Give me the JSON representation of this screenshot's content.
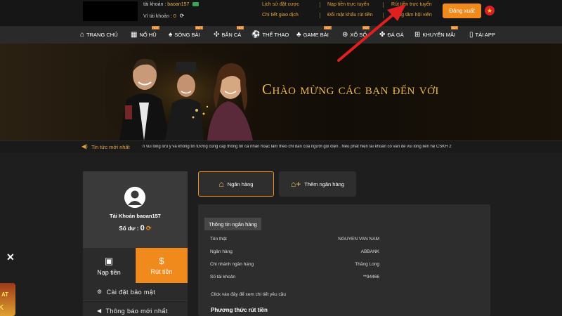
{
  "account": {
    "username_label": "tài khoản :",
    "username": "baoan157",
    "wallet_label": "Ví tài khoản :",
    "wallet_value": "0"
  },
  "top_links": [
    {
      "label": "Lịch sử đặt cược"
    },
    {
      "label": "Nạp tiền trực tuyến"
    },
    {
      "label": "Rút tiền trực tuyến"
    },
    {
      "label": "Chi tiết giao dịch"
    },
    {
      "label": "Đổi mật khẩu rút tiền"
    },
    {
      "label": "Trung tâm hội viên"
    }
  ],
  "logout_label": "Đăng xuất",
  "nav": [
    {
      "label": "TRANG CHỦ",
      "icon": "home-icon"
    },
    {
      "label": "NỔ HŨ",
      "icon": "slot-icon"
    },
    {
      "label": "SÒNG BÀI",
      "icon": "casino-icon"
    },
    {
      "label": "BẮN CÁ",
      "icon": "fish-icon"
    },
    {
      "label": "THỂ THAO",
      "icon": "soccer-ball-icon"
    },
    {
      "label": "GAME BÀI",
      "icon": "cards-icon"
    },
    {
      "label": "XỔ SỐ",
      "icon": "lottery-icon"
    },
    {
      "label": "ĐÁ GÀ",
      "icon": "rooster-icon"
    },
    {
      "label": "KHUYẾN MÃI",
      "icon": "gift-icon"
    },
    {
      "label": "TẢI APP",
      "icon": "phone-icon"
    }
  ],
  "hot_badge": "HOT",
  "banner": {
    "title": "Chào mừng các bạn đến với"
  },
  "ticker": {
    "label": "Tin tức mới nhất",
    "text": "n vui lòng lưu ý và không tin tưởng cung cấp thông tin cá nhân hoặc làm theo chỉ dẫn của người gọi điện . Nếu phát hiện tài khoản có vấn đề vui lòng liên hệ CSKH 2"
  },
  "profile": {
    "account_label": "Tài Khoản",
    "username": "baoan157",
    "balance_label": "Số dư :",
    "balance": "0"
  },
  "actions": {
    "deposit": "Nạp tiền",
    "withdraw": "Rút tiền"
  },
  "menu": [
    {
      "label": "Cài đặt bảo mật",
      "icon": "user-gear-icon"
    },
    {
      "label": "Thông báo mới nhất",
      "icon": "megaphone-icon"
    }
  ],
  "tabs": {
    "bank": "Ngân hàng",
    "add_bank": "Thêm ngân hàng"
  },
  "bank_info": {
    "header": "Thông tin ngân hàng",
    "rows": [
      {
        "key": "Tên thật",
        "value": "NGUYEN VAN NAM"
      },
      {
        "key": "Ngân hàng",
        "value": "ABBANK"
      },
      {
        "key": "Chi nhánh ngân hàng",
        "value": "Thăng Long"
      },
      {
        "key": "Số tài khoản",
        "value": "**94466"
      }
    ],
    "note": "Click vào đây để xem chi tiết yêu cầu",
    "method": "Phương thức rút tiền"
  },
  "colors": {
    "accent_orange": "#f08a1c",
    "gold_text": "#e8a23a",
    "arrow_red": "#e02020"
  }
}
